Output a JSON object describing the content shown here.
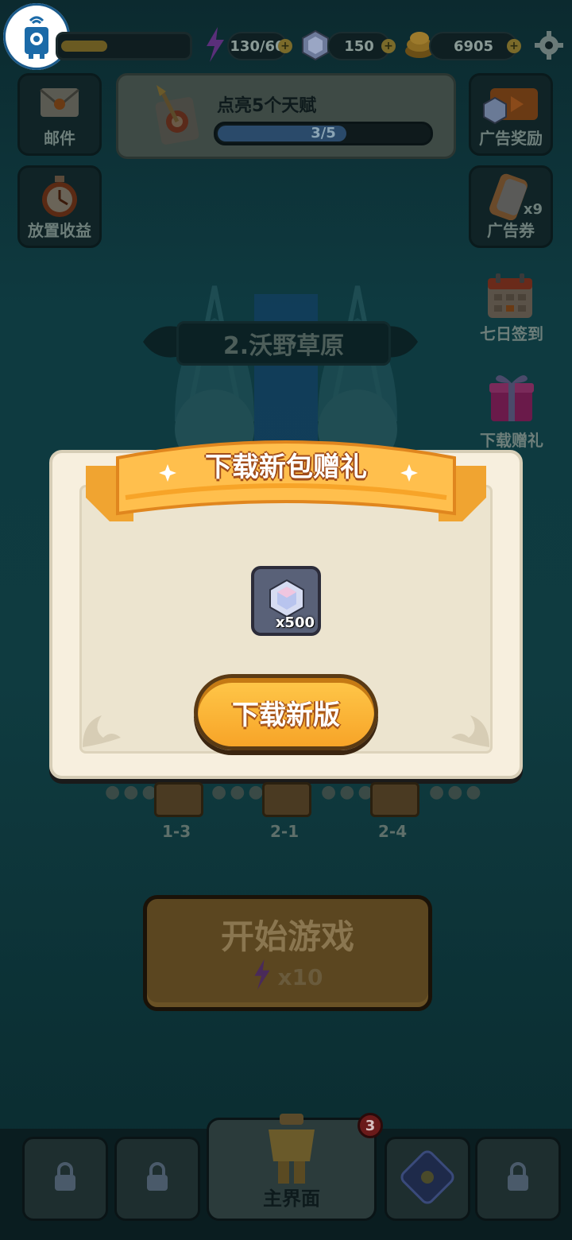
{
  "top_bar": {
    "energy": "130/60",
    "gems": "150",
    "coins": "6905",
    "plus": "+"
  },
  "side_left": [
    {
      "label": "邮件",
      "icon": "mail-icon"
    },
    {
      "label": "放置收益",
      "icon": "stopwatch-icon"
    }
  ],
  "side_right": [
    {
      "label": "广告奖励",
      "icon": "ad-reward-icon"
    },
    {
      "label": "广告券",
      "icon": "ad-ticket-icon",
      "count": "x9"
    },
    {
      "label": "七日签到",
      "icon": "calendar-icon"
    },
    {
      "label": "下载赠礼",
      "icon": "gift-icon"
    }
  ],
  "quest": {
    "title": "点亮5个天赋",
    "progress_text": "3/5",
    "progress": 0.6
  },
  "stage": {
    "name": "2.沃野草原"
  },
  "modal": {
    "title": "下载新包赠礼",
    "reward_count": "x500",
    "reward_icon": "gem-icon",
    "button_label": "下载新版"
  },
  "levels": [
    {
      "label": "1-3"
    },
    {
      "label": "2-1"
    },
    {
      "label": "2-4"
    }
  ],
  "start": {
    "label": "开始游戏",
    "cost": "x10"
  },
  "bottom_nav": {
    "main_label": "主界面",
    "badge": "3"
  },
  "colors": {
    "accent": "#f7a428",
    "background": "#0e3a40",
    "modal": "#f7efde"
  }
}
